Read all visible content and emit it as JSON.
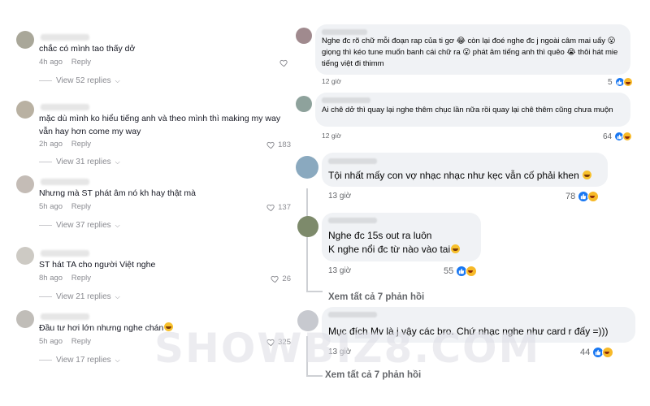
{
  "tiktok_comments": [
    {
      "text": "chắc có mình tao thấy dở",
      "time": "4h ago",
      "reply_label": "Reply",
      "likes": "",
      "view_replies": "View 52 replies"
    },
    {
      "text": "mặc dù mình ko hiểu tiếng anh và theo mình thì making my way vẫn hay hơn come my way",
      "time": "2h ago",
      "reply_label": "Reply",
      "likes": "183",
      "view_replies": "View 31 replies"
    },
    {
      "text": "Nhưng mà ST phát âm nó kh hay thật mà",
      "time": "5h ago",
      "reply_label": "Reply",
      "likes": "137",
      "view_replies": "View 37 replies"
    },
    {
      "text": "ST hát TA cho người Việt nghe",
      "time": "8h ago",
      "reply_label": "Reply",
      "likes": "26",
      "view_replies": "View 21 replies"
    },
    {
      "text": "Đầu tư hơi lớn nhưng nghe chán",
      "time": "5h ago",
      "reply_label": "Reply",
      "likes": "325",
      "view_replies": "View 17 replies"
    }
  ],
  "facebook_comments": [
    {
      "text": "Nghe đc rõ chữ mỗi đoạn rap của ti gơ 😂 còn lại đoé nghe đc j ngoài câm mai uẩy 😮 giọng thì kéo tune muốn banh cái chữ ra 😮 phát âm tiếng anh thì quêo 😭 thôi hát mie tiếng việt đi thimm",
      "time": "12 giờ",
      "count": "5"
    },
    {
      "text": "Ai chê dở thì quay lại nghe thêm chục lần nữa rồi quay lại chê thêm cũng chưa muộn",
      "time": "12 giờ",
      "count": "64"
    },
    {
      "text": "Tội nhất mấy con vợ nhạc nhạc như kẹc vẫn cố phải khen",
      "time": "13 giờ",
      "count": "78"
    },
    {
      "text_line1": "Nghe đc 15s out ra luôn",
      "text_line2": "K nghe nổi đc từ nào vào tai",
      "time": "13 giờ",
      "count": "55"
    },
    {
      "text": "Mục đích Mv là j vậy các bro. Chứ nhạc nghe như card r đấy =)))",
      "time": "13 giờ",
      "count": "44"
    }
  ],
  "see_all_replies": [
    "Xem tất cả 7 phản hồi",
    "Xem tất cả 7 phản hồi"
  ],
  "watermark": "SHOWBIZ8.COM",
  "colors": {
    "like_blue": "#1877f2",
    "haha_yellow": "#f7b928",
    "bubble_bg": "#f0f2f5",
    "muted": "#65676b"
  }
}
